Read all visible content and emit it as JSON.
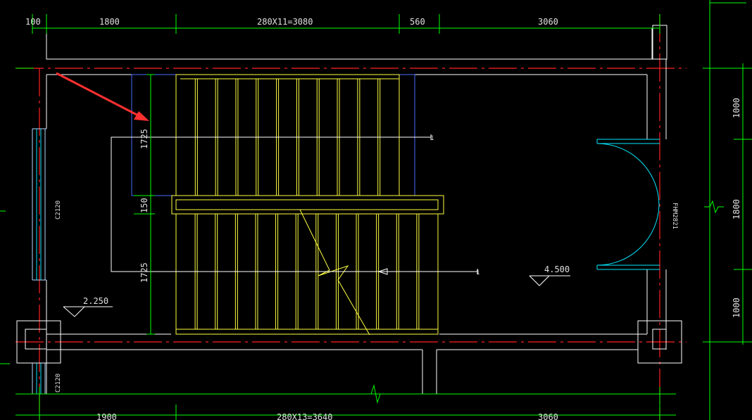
{
  "dimensions": {
    "top": [
      "100",
      "1800",
      "280X11=3080",
      "560",
      "3060"
    ],
    "bottom": [
      "1900",
      "280X13=3640",
      "3060"
    ],
    "right": [
      "1000",
      "1800",
      "1000"
    ],
    "flight_lengths": [
      "1725",
      "150",
      "1725"
    ]
  },
  "labels": {
    "window_left": "C2120",
    "window_bottom": "C2120",
    "door": "FHM2821",
    "elevation_low": "2.250",
    "elevation_high": "4.500",
    "up_mark_upper": "1",
    "up_mark_lower": "1"
  },
  "colors": {
    "background": "#000000",
    "wall": "#ffffff",
    "axis": "#ff0000",
    "dimension": "#00ff00",
    "stair": "#ffff00",
    "door": "#00ffff",
    "landing": "#4a6cff",
    "annotation_arrow": "#ff3030"
  }
}
